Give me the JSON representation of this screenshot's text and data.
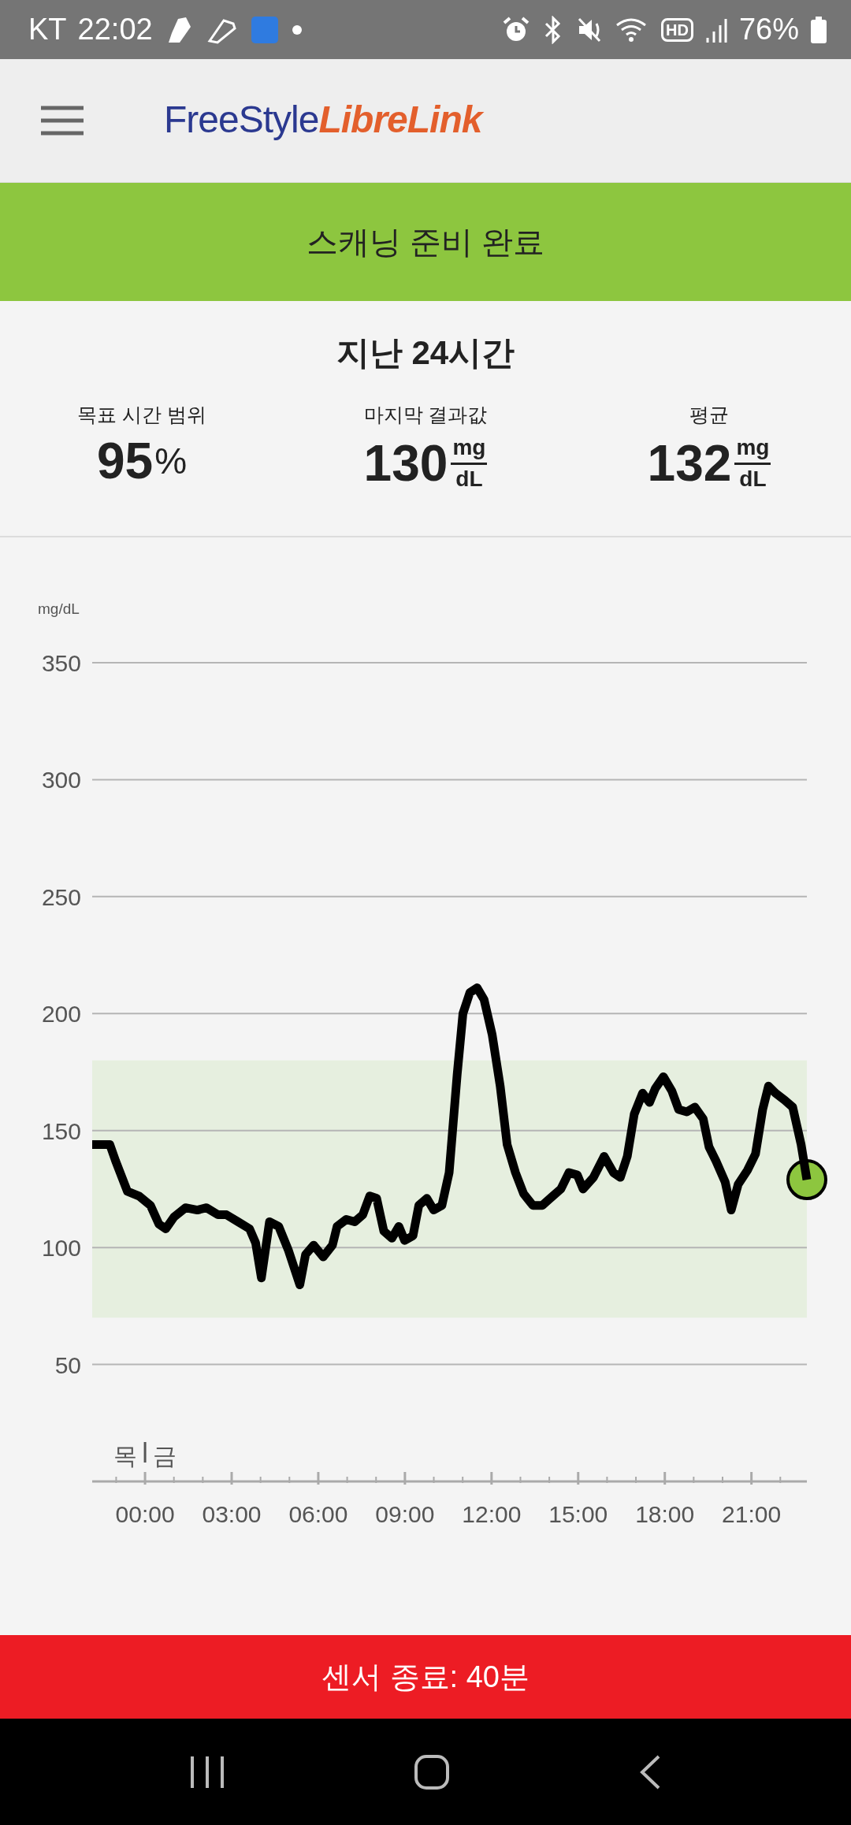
{
  "status_bar": {
    "carrier": "KT",
    "time": "22:02",
    "hd_badge": "HD",
    "battery": "76%"
  },
  "header": {
    "logo": {
      "part1": "FreeStyle",
      "part2": "LibreLink"
    }
  },
  "banner": {
    "text": "스캐닝 준비 완료"
  },
  "summary": {
    "title": "지난 24시간",
    "stats": [
      {
        "kind": "percent",
        "label": "목표 시간 범위",
        "value": "95",
        "unit": "%"
      },
      {
        "kind": "fraction",
        "label": "마지막 결과값",
        "value": "130",
        "unit_top": "mg",
        "unit_bottom": "dL"
      },
      {
        "kind": "fraction",
        "label": "평균",
        "value": "132",
        "unit_top": "mg",
        "unit_bottom": "dL"
      }
    ]
  },
  "chart": {
    "day_labels": [
      "목",
      "금"
    ],
    "chart_data": {
      "type": "line",
      "ylabel": "mg/dL",
      "xlim": [
        -1.83,
        22.92
      ],
      "ylim": [
        0,
        350
      ],
      "yticks": [
        50,
        100,
        150,
        200,
        250,
        300,
        350
      ],
      "xticks": [
        {
          "value": 0,
          "label": "00:00"
        },
        {
          "value": 3,
          "label": "03:00"
        },
        {
          "value": 6,
          "label": "06:00"
        },
        {
          "value": 9,
          "label": "09:00"
        },
        {
          "value": 12,
          "label": "12:00"
        },
        {
          "value": 15,
          "label": "15:00"
        },
        {
          "value": 18,
          "label": "18:00"
        },
        {
          "value": 21,
          "label": "21:00"
        }
      ],
      "grid": true,
      "bands": [
        {
          "axis": "y",
          "from": 70,
          "to": 180,
          "color": "#e6efdf"
        }
      ],
      "x": [
        -1.83,
        -1.22,
        -1.02,
        -0.61,
        -0.21,
        0.19,
        0.48,
        0.72,
        1.0,
        1.4,
        1.81,
        2.13,
        2.53,
        2.82,
        3.22,
        3.62,
        3.83,
        4.03,
        4.31,
        4.63,
        4.96,
        5.36,
        5.56,
        5.84,
        6.17,
        6.49,
        6.65,
        6.97,
        7.26,
        7.54,
        7.78,
        8.02,
        8.27,
        8.55,
        8.79,
        8.99,
        9.28,
        9.48,
        9.76,
        10.0,
        10.28,
        10.53,
        10.81,
        11.01,
        11.25,
        11.5,
        11.74,
        12.02,
        12.3,
        12.54,
        12.83,
        13.11,
        13.43,
        13.76,
        14.12,
        14.4,
        14.68,
        14.97,
        15.17,
        15.53,
        15.9,
        16.22,
        16.46,
        16.7,
        16.94,
        17.23,
        17.47,
        17.67,
        17.95,
        18.24,
        18.48,
        18.76,
        19.04,
        19.33,
        19.53,
        19.77,
        20.09,
        20.3,
        20.54,
        20.86,
        21.14,
        21.39,
        21.59,
        21.83,
        22.15,
        22.43,
        22.72,
        22.92
      ],
      "series": [
        {
          "color": "#000000",
          "values": [
            144,
            144,
            137,
            124,
            122,
            118,
            110,
            108,
            113,
            117,
            116,
            117,
            114,
            114,
            111,
            108,
            102,
            87,
            111,
            109,
            99,
            84,
            97,
            101,
            96,
            101,
            109,
            112,
            111,
            114,
            122,
            121,
            107,
            104,
            109,
            103,
            105,
            118,
            121,
            116,
            118,
            132,
            174,
            200,
            209,
            211,
            206,
            191,
            169,
            144,
            132,
            123,
            118,
            118,
            122,
            125,
            132,
            131,
            125,
            130,
            139,
            132,
            130,
            139,
            157,
            166,
            162,
            168,
            173,
            167,
            159,
            158,
            160,
            155,
            143,
            137,
            128,
            116,
            127,
            133,
            140,
            159,
            169,
            166,
            163,
            160,
            144,
            129
          ]
        }
      ]
    }
  },
  "footer": {
    "text": "센서 종료: 40분"
  }
}
